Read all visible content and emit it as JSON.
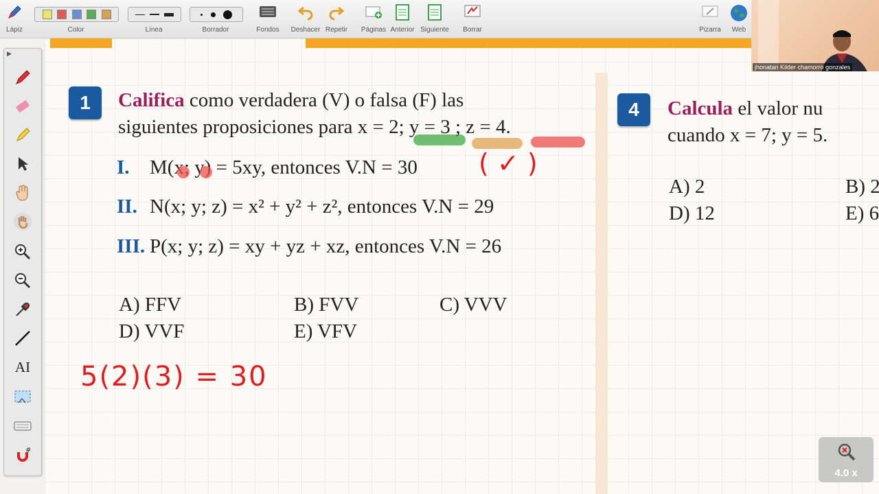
{
  "toolbar": {
    "lapiz": "Lápiz",
    "color": "Color",
    "linea": "Línea",
    "borrador": "Borrador",
    "fondos": "Fondos",
    "deshacer": "Deshacer",
    "repetir": "Repetir",
    "paginas": "Páginas",
    "anterior": "Anterior",
    "siguiente": "Siguiente",
    "borrar": "Borrar",
    "pizarra": "Pizarra",
    "web": "Web",
    "swatch_colors": [
      "#e8e86a",
      "#e05a5a",
      "#6a8fd0",
      "#5aab5a",
      "#d8a050"
    ]
  },
  "sidebar": {
    "tools": [
      "pen-icon",
      "eraser-icon",
      "highlighter-icon",
      "pointer-icon",
      "hand-icon",
      "palm-icon",
      "zoom-in-icon",
      "zoom-out-icon",
      "pipette-icon",
      "line-icon",
      "text-icon",
      "screenshot-icon",
      "keyboard-icon",
      "magnet-icon"
    ],
    "text_tool": "AI"
  },
  "q1": {
    "number": "1",
    "verb": "Califica",
    "line1_rest": " como verdadera (V) o falsa (F) las",
    "line2": "siguientes proposiciones para x = 2; y = 3 ; z = 4.",
    "items": [
      {
        "roman": "I.",
        "text": "M(x; y) = 5xy, entonces V.N = 30"
      },
      {
        "roman": "II.",
        "text": "N(x; y; z) = x² + y² + z², entonces V.N = 29"
      },
      {
        "roman": "III.",
        "text": "P(x; y; z) = xy + yz + xz, entonces V.N = 26"
      }
    ],
    "options": {
      "a": "A) FFV",
      "b": "B) FVV",
      "c": "C) VVV",
      "d": "D) VVF",
      "e": "E) VFV"
    }
  },
  "annotations": {
    "handwritten_calc": "5(2)(3) = 30",
    "check_mark": "( ✓ )",
    "highlight_colors": [
      "#6fbf73",
      "#e6b87a",
      "#f07a78"
    ]
  },
  "q4": {
    "number": "4",
    "verb": "Calcula",
    "line1_rest": " el valor nu",
    "line2": "cuando x = 7; y = 5.",
    "options": {
      "a": "A) 2",
      "b": "B) 2",
      "d": "D) 12",
      "e": "E) 6"
    }
  },
  "webcam": {
    "name": "jhonatan Kilder chamorro gonzales"
  },
  "zoom": {
    "level": "4.0 x"
  }
}
